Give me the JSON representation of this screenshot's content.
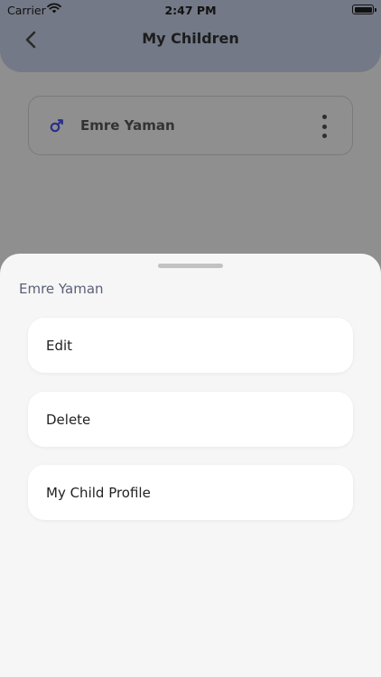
{
  "status_bar": {
    "carrier": "Carrier",
    "time": "2:47 PM"
  },
  "header": {
    "title": "My Children",
    "back_icon": "chevron-left-icon"
  },
  "children": [
    {
      "name": "Emre Yaman",
      "gender_icon": "male-symbol-icon",
      "gender_icon_color": "#2a2f8a"
    }
  ],
  "sheet": {
    "title": "Emre Yaman",
    "options": [
      {
        "label": "Edit"
      },
      {
        "label": "Delete"
      },
      {
        "label": "My Child Profile"
      }
    ]
  },
  "colors": {
    "sheet_background": "#f6f6f6",
    "overlay": "#8f8f8f",
    "sheet_title": "#5a6178"
  }
}
